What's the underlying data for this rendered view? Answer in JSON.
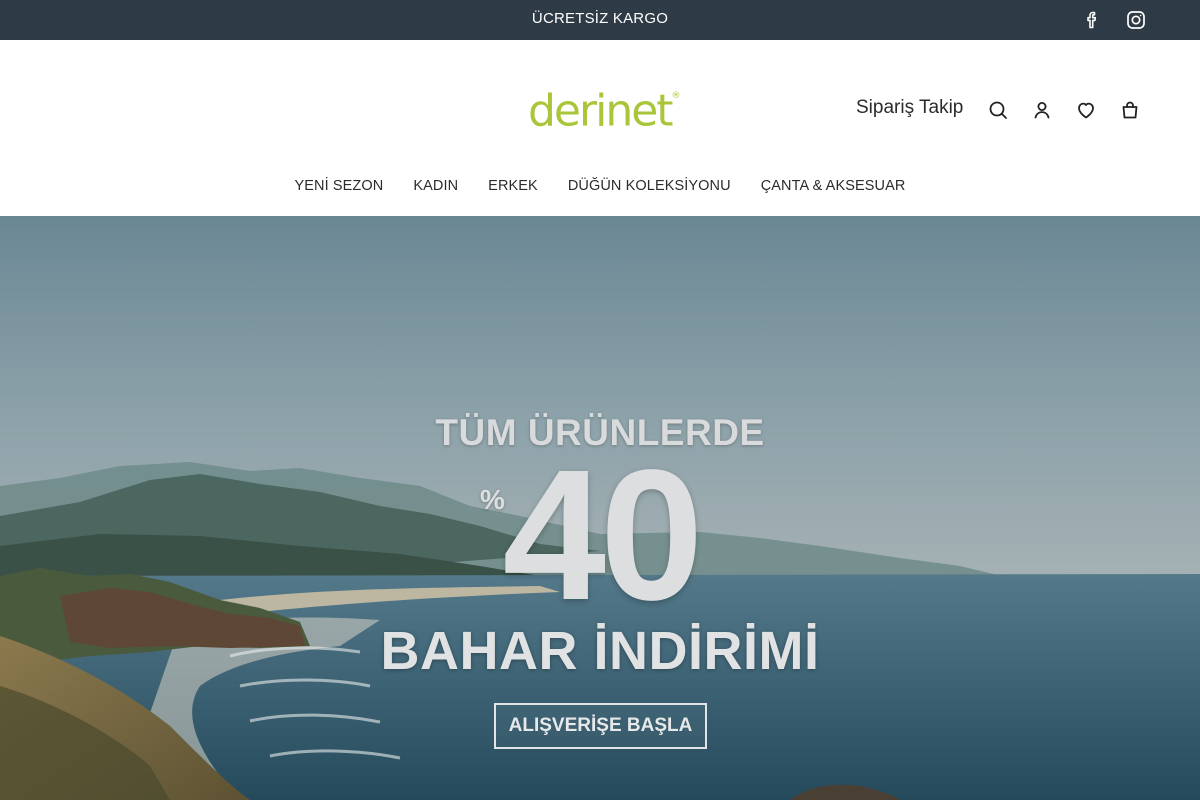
{
  "announcement": {
    "text": "ÜCRETSİZ KARGO"
  },
  "social": [
    {
      "icon": "facebook-icon"
    },
    {
      "icon": "instagram-icon"
    }
  ],
  "header": {
    "logo_text": "derinet",
    "logo_mark": "®",
    "logo_color": "#a9c63a",
    "order_tracking": "Sipariş Takip",
    "icons": [
      "search-icon",
      "account-icon",
      "wishlist-icon",
      "cart-icon"
    ]
  },
  "nav": {
    "items": [
      {
        "label": "YENİ SEZON"
      },
      {
        "label": "KADIN"
      },
      {
        "label": "ERKEK"
      },
      {
        "label": "DÜĞÜN KOLEKSİYONU"
      },
      {
        "label": "ÇANTA & AKSESUAR"
      }
    ]
  },
  "hero": {
    "headline": "TÜM ÜRÜNLERDE",
    "percent_sign": "%",
    "discount": "40",
    "subheadline": "BAHAR İNDİRİMİ",
    "cta_label": "ALIŞVERİŞE BAŞLA"
  },
  "colors": {
    "topbar_bg": "#2e3a45",
    "text_dark": "#2b2b2b"
  }
}
